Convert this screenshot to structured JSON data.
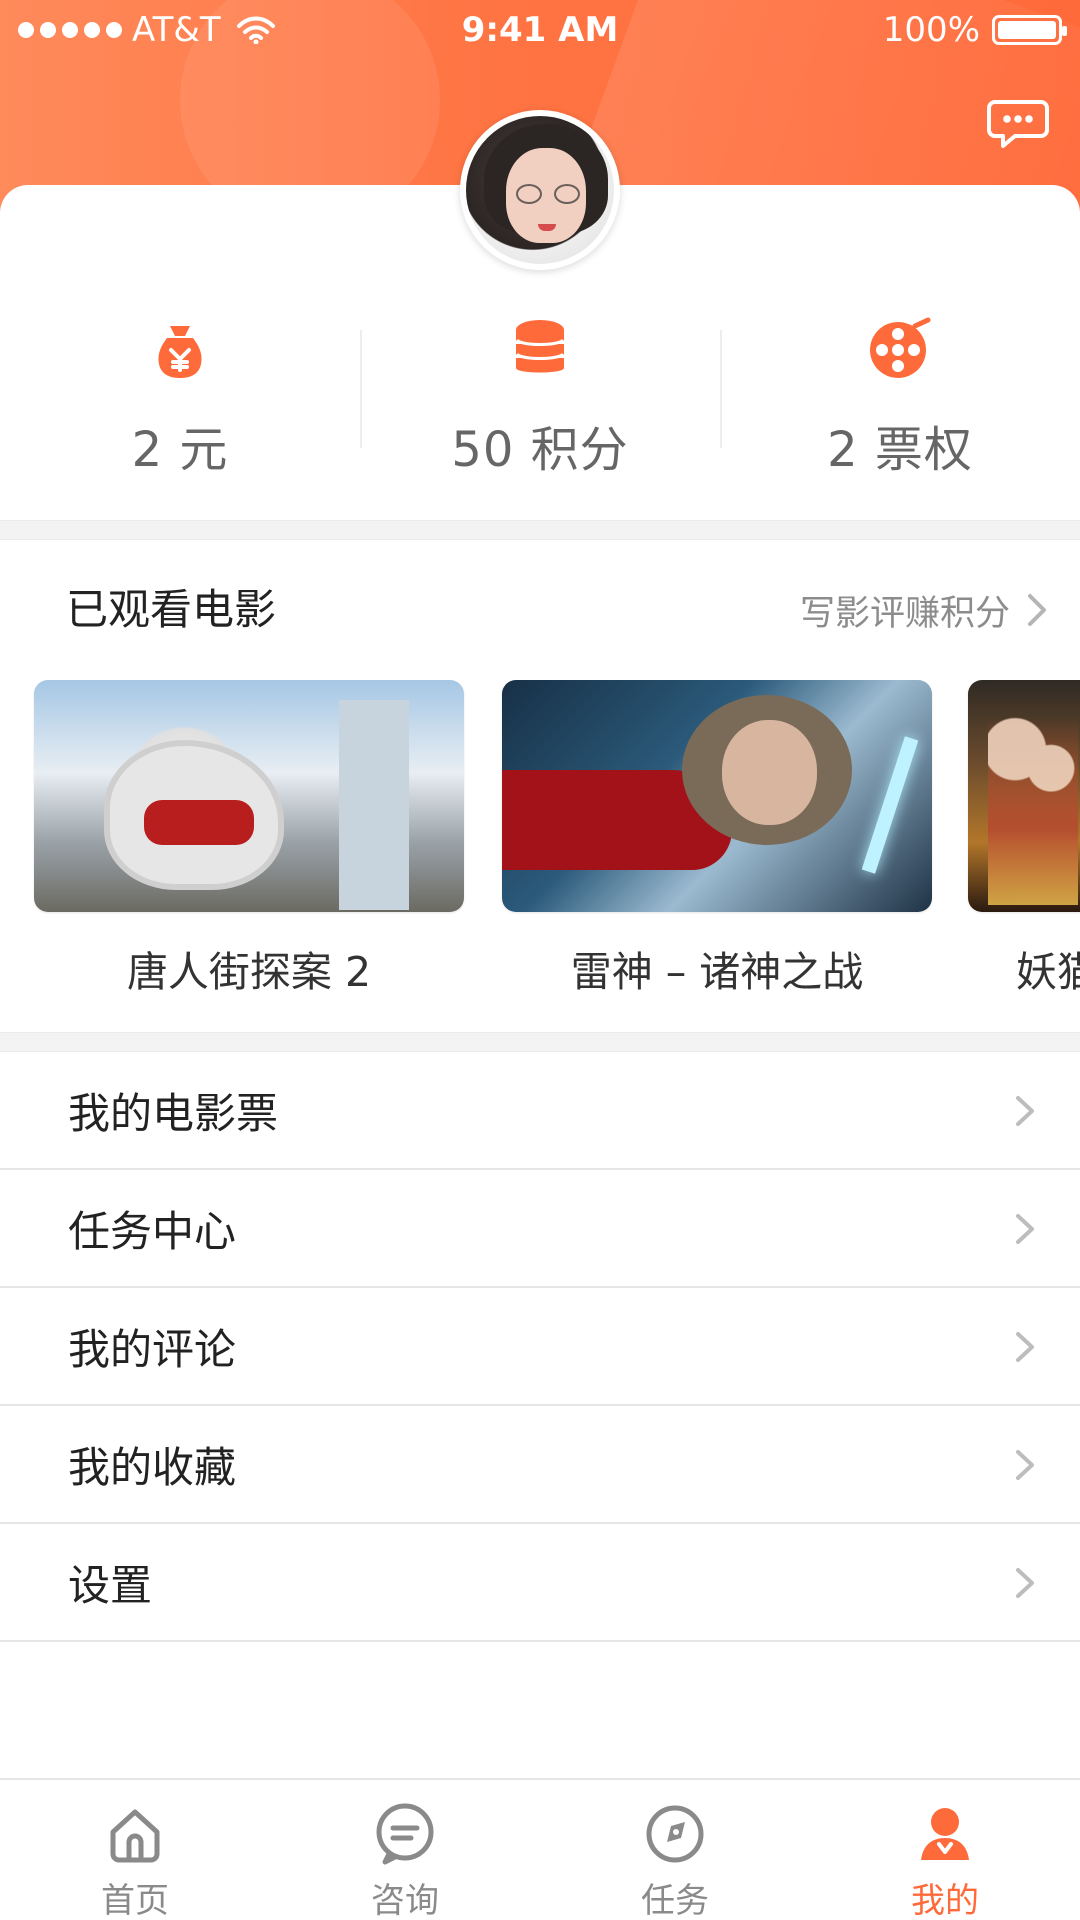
{
  "status_bar": {
    "carrier": "AT&T",
    "time": "9:41 AM",
    "battery": "100%"
  },
  "header": {
    "message_icon": "chat-bubble-icon"
  },
  "profile": {
    "avatar": "avatar"
  },
  "stats": [
    {
      "icon": "money-bag-yen-icon",
      "value": "2 元"
    },
    {
      "icon": "coin-stack-icon",
      "value": "50 积分"
    },
    {
      "icon": "film-reel-icon",
      "value": "2 票权"
    }
  ],
  "watched": {
    "title": "已观看电影",
    "link": "写影评赚积分",
    "movies": [
      {
        "title": "唐人街探案 2"
      },
      {
        "title": "雷神 – 诸神之战"
      },
      {
        "title": "妖猫"
      }
    ]
  },
  "menu": [
    {
      "label": "我的电影票"
    },
    {
      "label": "任务中心"
    },
    {
      "label": "我的评论"
    },
    {
      "label": "我的收藏"
    },
    {
      "label": "设置"
    }
  ],
  "tabbar": {
    "tabs": [
      {
        "label": "首页",
        "icon": "home-icon",
        "active": false
      },
      {
        "label": "咨询",
        "icon": "message-icon",
        "active": false
      },
      {
        "label": "任务",
        "icon": "compass-icon",
        "active": false
      },
      {
        "label": "我的",
        "icon": "user-icon",
        "active": true
      }
    ]
  },
  "colors": {
    "accent": "#FF6A3A",
    "text_primary": "#222222",
    "text_secondary": "#8C8C8C",
    "divider": "#E6E6E6"
  }
}
